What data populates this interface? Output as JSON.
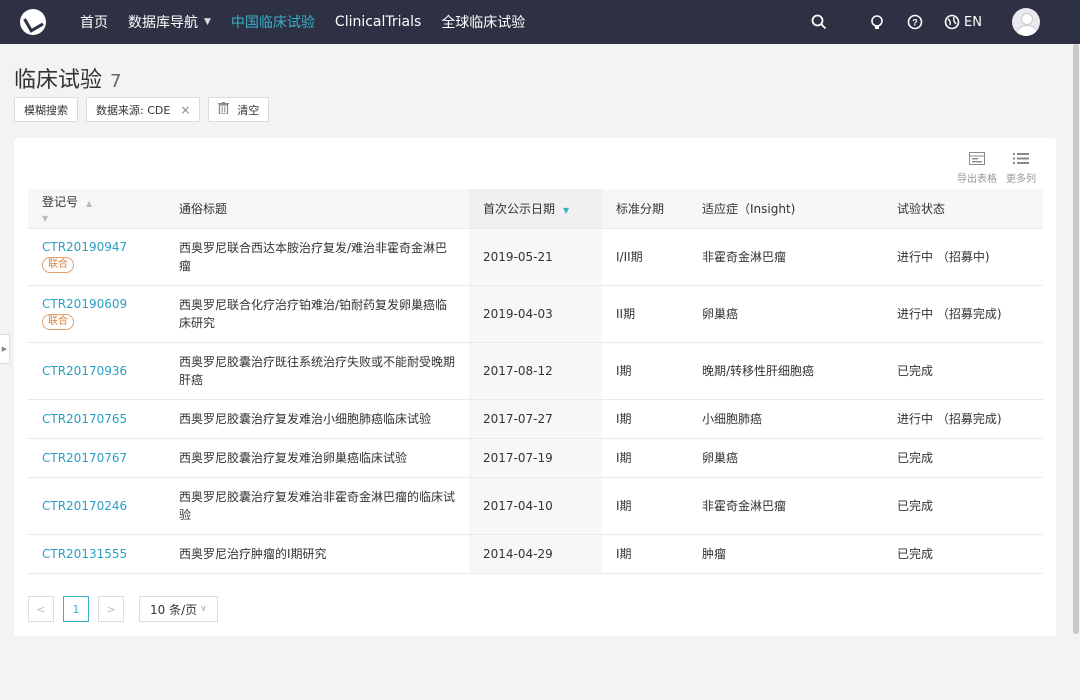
{
  "nav": {
    "items": [
      {
        "label": "首页",
        "active": false
      },
      {
        "label": "数据库导航",
        "active": false,
        "has_dropdown": true
      },
      {
        "label": "中国临床试验",
        "active": true
      },
      {
        "label": "ClinicalTrials",
        "active": false
      },
      {
        "label": "全球临床试验",
        "active": false
      }
    ],
    "lang": "EN",
    "icons": [
      "search-icon",
      "lightbulb-icon",
      "help-icon",
      "globe-icon"
    ]
  },
  "page": {
    "title": "临床试验",
    "count": "7"
  },
  "filters": {
    "fuzzy": "模糊搜索",
    "source": "数据来源: CDE",
    "remove": "×",
    "clear": "清空"
  },
  "tools": {
    "export": "导出表格",
    "more_columns": "更多列"
  },
  "table": {
    "headers": [
      "登记号",
      "通俗标题",
      "首次公示日期",
      "标准分期",
      "适应症（Insight)",
      "试验状态"
    ],
    "rows": [
      {
        "id": "CTR20190947",
        "tag": "联合",
        "title": "西奥罗尼联合西达本胺治疗复发/难治非霍奇金淋巴瘤",
        "date": "2019-05-21",
        "phase": "I/II期",
        "indication": "非霍奇金淋巴瘤",
        "status": "进行中 （招募中)"
      },
      {
        "id": "CTR20190609",
        "tag": "联合",
        "title": "西奥罗尼联合化疗治疗铂难治/铂耐药复发卵巢癌临床研究",
        "date": "2019-04-03",
        "phase": "II期",
        "indication": "卵巢癌",
        "status": "进行中 （招募完成)"
      },
      {
        "id": "CTR20170936",
        "tag": "",
        "title": "西奥罗尼胶囊治疗既往系统治疗失败或不能耐受晚期肝癌",
        "date": "2017-08-12",
        "phase": "I期",
        "indication": "晚期/转移性肝细胞癌",
        "status": "已完成"
      },
      {
        "id": "CTR20170765",
        "tag": "",
        "title": "西奥罗尼胶囊治疗复发难治小细胞肺癌临床试验",
        "date": "2017-07-27",
        "phase": "I期",
        "indication": "小细胞肺癌",
        "status": "进行中 （招募完成)"
      },
      {
        "id": "CTR20170767",
        "tag": "",
        "title": "西奥罗尼胶囊治疗复发难治卵巢癌临床试验",
        "date": "2017-07-19",
        "phase": "I期",
        "indication": "卵巢癌",
        "status": "已完成"
      },
      {
        "id": "CTR20170246",
        "tag": "",
        "title": "西奥罗尼胶囊治疗复发难治非霍奇金淋巴瘤的临床试验",
        "date": "2017-04-10",
        "phase": "I期",
        "indication": "非霍奇金淋巴瘤",
        "status": "已完成"
      },
      {
        "id": "CTR20131555",
        "tag": "",
        "title": "西奥罗尼治疗肿瘤的I期研究",
        "date": "2014-04-29",
        "phase": "I期",
        "indication": "肿瘤",
        "status": "已完成"
      }
    ]
  },
  "pagination": {
    "prev": "<",
    "current": "1",
    "next": ">",
    "per_page": "10 条/页"
  },
  "colors": {
    "nav_bg": "#2e3043",
    "accent": "#3bb0c9",
    "link": "#2a9fc2",
    "tag": "#d9803b"
  }
}
